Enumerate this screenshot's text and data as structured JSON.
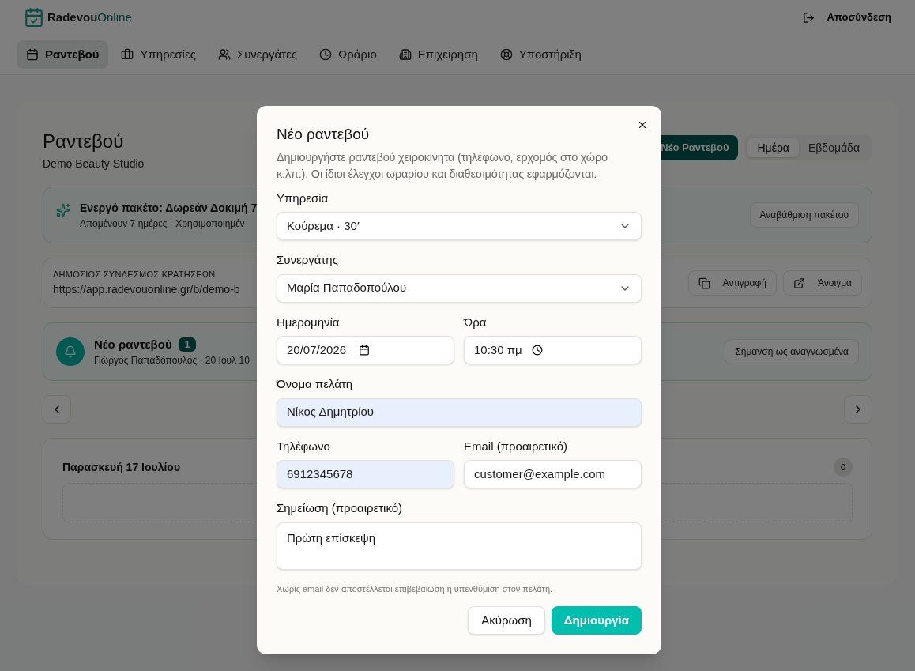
{
  "header": {
    "logo_text": "Radevou",
    "logo_accent": "Online",
    "logout": "Αποσύνδεση"
  },
  "nav": [
    {
      "label": "Ραντεβού",
      "selected": true
    },
    {
      "label": "Υπηρεσίες",
      "selected": false
    },
    {
      "label": "Συνεργάτες",
      "selected": false
    },
    {
      "label": "Ωράριο",
      "selected": false
    },
    {
      "label": "Επιχείρηση",
      "selected": false
    },
    {
      "label": "Υποστήριξη",
      "selected": false
    }
  ],
  "page": {
    "title": "Ραντεβού",
    "subtitle": "Demo Beauty Studio",
    "new_button": "Νέο Ραντεβού",
    "views": [
      {
        "label": "Ημέρα",
        "selected": true
      },
      {
        "label": "Εβδομάδα",
        "selected": false
      }
    ],
    "plan": {
      "title": "Ενεργό πακέτο: Δωρεάν Δοκιμή 7",
      "detail": "Απομένουν 7 ημέρες · Χρησιμοποιημέν",
      "button": "Αναβάθμιση πακέτου"
    },
    "link": {
      "label": "ΔΗΜΟΣΙΟΣ ΣΥΝΔΕΣΜΟΣ ΚΡΑΤΗΣΕΩΝ",
      "url": "https://app.radevouonline.gr/b/demo-b",
      "copy": "Αντιγραφή",
      "open": "Άνοιγμα"
    },
    "notice": {
      "title": "Νέο ραντεβού",
      "count": "1",
      "detail": "Γιώργος Παπαδόπουλος · 20 Ιουλ 10",
      "button": "Σήμανση ως αναγνωσμένα"
    },
    "day": {
      "title": "Παρασκευή 17 Ιουλίου",
      "count": "0"
    }
  },
  "dialog": {
    "title": "Νέο ραντεβού",
    "description": "Δημιουργήστε ραντεβού χειροκίνητα (τηλέφωνο, ερχομός στο χώρο κ.λπ.). Οι ίδιοι έλεγχοι ωραρίου και διαθεσιμότητας εφαρμόζονται.",
    "rows": [
      [
        {
          "kind": "select",
          "label": "Υπηρεσία",
          "value": "Κούρεμα · 30′",
          "autofilled": false
        }
      ],
      [
        {
          "kind": "select",
          "label": "Συνεργάτης",
          "value": "Μαρία Παπαδοπούλου",
          "autofilled": false
        }
      ],
      [
        {
          "kind": "date",
          "label": "Ημερομηνία",
          "value": "20/07/2026",
          "autofilled": false
        },
        {
          "kind": "time",
          "label": "Ώρα",
          "value": "10:30 πμ",
          "autofilled": false
        }
      ],
      [
        {
          "kind": "text",
          "label": "Όνομα πελάτη",
          "value": "Νίκος Δημητρίου",
          "autofilled": true
        }
      ],
      [
        {
          "kind": "text",
          "label": "Τηλέφωνο",
          "value": "6912345678",
          "autofilled": true
        },
        {
          "kind": "text",
          "label": "Email (προαιρετικό)",
          "value": "customer@example.com",
          "autofilled": false
        }
      ],
      [
        {
          "kind": "textarea",
          "label": "Σημείωση (προαιρετικό)",
          "value": "Πρώτη επίσκεψη",
          "autofilled": false
        }
      ]
    ],
    "hint": "Χωρίς email δεν αποστέλλεται επιβεβαίωση ή υπενθύμιση στον πελάτη.",
    "cancel": "Ακύρωση",
    "submit": "Δημιουργία"
  }
}
